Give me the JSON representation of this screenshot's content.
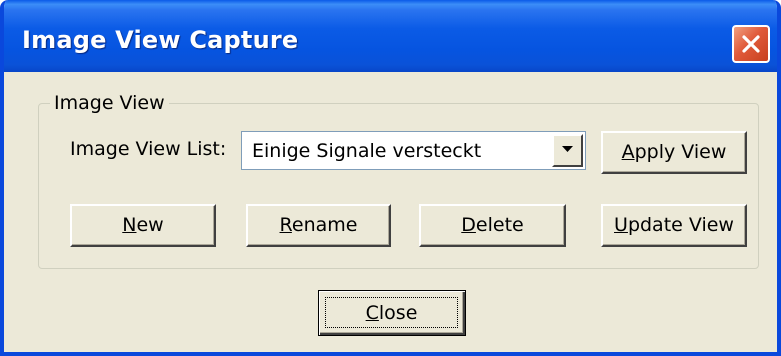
{
  "window": {
    "title": "Image View Capture",
    "close_icon": "close-icon",
    "close_color": "#e05a3a"
  },
  "group": {
    "legend": "Image View"
  },
  "view_list": {
    "label": "Image View List:",
    "selected": "Einige Signale versteckt",
    "arrow_icon": "dropdown-arrow-icon"
  },
  "buttons": {
    "apply_view": {
      "mnemonic": "A",
      "rest": "pply View"
    },
    "new": {
      "mnemonic": "N",
      "rest": "ew"
    },
    "rename": {
      "mnemonic": "R",
      "rest": "ename"
    },
    "delete": {
      "mnemonic": "D",
      "rest": "elete"
    },
    "update_view": {
      "mnemonic": "U",
      "rest": "pdate View"
    },
    "close": {
      "mnemonic": "C",
      "rest": "lose"
    }
  }
}
